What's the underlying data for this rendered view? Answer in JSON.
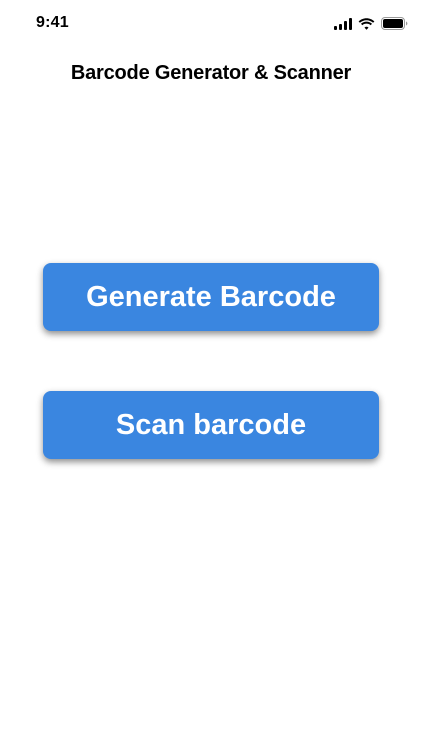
{
  "status_bar": {
    "time": "9:41",
    "icons": [
      "cellular-signal-icon",
      "wifi-icon",
      "battery-icon"
    ]
  },
  "header": {
    "title": "Barcode Generator & Scanner"
  },
  "main": {
    "generate_label": "Generate Barcode",
    "scan_label": "Scan barcode"
  },
  "colors": {
    "button_background": "#3a86e0",
    "button_text": "#ffffff",
    "page_background": "#ffffff"
  }
}
